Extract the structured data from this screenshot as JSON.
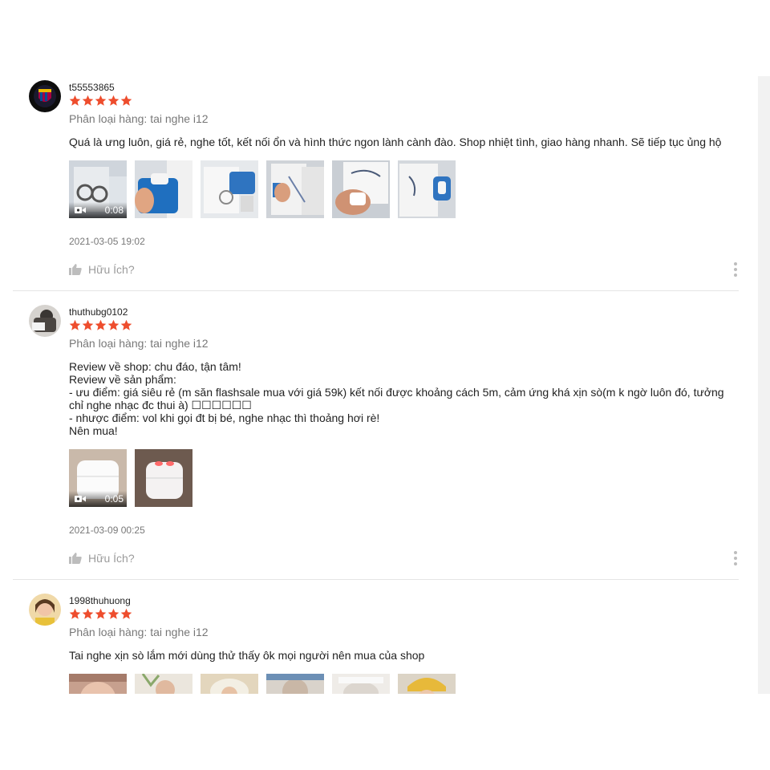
{
  "colors": {
    "star": "#ee4d2d",
    "muted": "#757575",
    "divider": "#e5e5e5"
  },
  "reviews": [
    {
      "username": "t55553865",
      "rating": 5,
      "variation": "Phân loại hàng: tai nghe i12",
      "comment_lines": [
        "Quá là ưng luôn, giá rẻ, nghe tốt, kết nối ổn và hình thức ngon lành cành đào. Shop nhiệt tình, giao hàng nhanh. Sẽ tiếp tục ủng hộ"
      ],
      "video_duration": "0:08",
      "timestamp": "2021-03-05 19:02",
      "helpful_label": "Hữu Ích?"
    },
    {
      "username": "thuthubg0102",
      "rating": 5,
      "variation": "Phân loại hàng: tai nghe i12",
      "comment_lines": [
        "Review về shop: chu đáo, tận tâm!",
        "Review về sản phẩm:",
        "- ưu điểm: giá siêu rẻ (m săn flashsale mua với giá 59k) kết nối được khoảng cách 5m, cảm ứng khá xịn sò(m k ngờ luôn đó, tưởng chỉ nghe nhạc đc thui à) ☐☐☐☐☐☐",
        "- nhược điểm: vol khi gọi đt bị bé, nghe nhạc thì thoảng hơi rè!",
        "Nên mua!"
      ],
      "video_duration": "0:05",
      "timestamp": "2021-03-09 00:25",
      "helpful_label": "Hữu Ích?"
    },
    {
      "username": "1998thuhuong",
      "rating": 5,
      "variation": "Phân loại hàng: tai nghe i12",
      "comment_lines": [
        "Tai nghe xịn sò lắm mới dùng thử thấy ôk mọi người nên mua của shop"
      ]
    }
  ]
}
